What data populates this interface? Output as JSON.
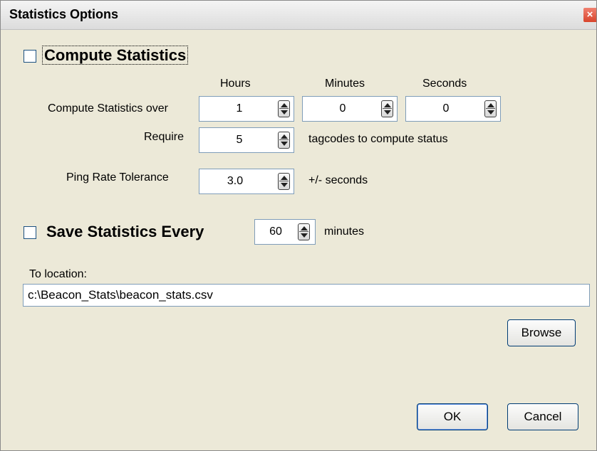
{
  "window": {
    "title": "Statistics Options"
  },
  "compute": {
    "checkbox_label": "Compute Statistics",
    "checked": false,
    "headers": {
      "hours": "Hours",
      "minutes": "Minutes",
      "seconds": "Seconds"
    },
    "over_label": "Compute Statistics over",
    "hours_value": "1",
    "minutes_value": "0",
    "seconds_value": "0",
    "require_label": "Require",
    "require_value": "5",
    "require_suffix": "tagcodes to compute status",
    "ping_label": "Ping Rate Tolerance",
    "ping_value": "3.0",
    "ping_suffix": "+/- seconds"
  },
  "save": {
    "checkbox_label": "Save Statistics Every",
    "checked": false,
    "interval_value": "60",
    "interval_suffix": "minutes",
    "location_label": "To location:",
    "location_value": "c:\\Beacon_Stats\\beacon_stats.csv"
  },
  "buttons": {
    "browse": "Browse",
    "ok": "OK",
    "cancel": "Cancel",
    "close": "×"
  },
  "colors": {
    "dialog_bg": "#ece9d8",
    "close_red": "#d8442c",
    "border_blue": "#7f9db9"
  }
}
